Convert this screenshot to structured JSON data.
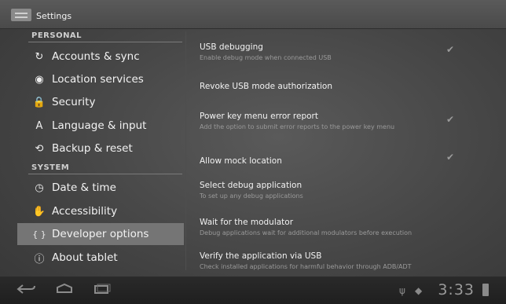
{
  "app_bar": {
    "title": "Settings",
    "icon": "settings-icon"
  },
  "sidebar": {
    "sections": [
      {
        "header": "PERSONAL",
        "items": [
          {
            "label": "Accounts & sync",
            "icon": "sync-icon",
            "glyph": "↻"
          },
          {
            "label": "Location services",
            "icon": "location-icon",
            "glyph": "◉"
          },
          {
            "label": "Security",
            "icon": "lock-icon",
            "glyph": "🔒"
          },
          {
            "label": "Language & input",
            "icon": "language-icon",
            "glyph": "A"
          },
          {
            "label": "Backup & reset",
            "icon": "backup-icon",
            "glyph": "⟲"
          }
        ]
      },
      {
        "header": "SYSTEM",
        "items": [
          {
            "label": "Date & time",
            "icon": "clock-icon",
            "glyph": "◷"
          },
          {
            "label": "Accessibility",
            "icon": "hand-icon",
            "glyph": "✋"
          },
          {
            "label": "Developer options",
            "icon": "braces-icon",
            "glyph": "{ }",
            "selected": true
          },
          {
            "label": "About tablet",
            "icon": "info-icon",
            "glyph": "ⓘ"
          }
        ]
      }
    ]
  },
  "settings": [
    {
      "title": "USB debugging",
      "summary": "Enable debug mode when connected USB",
      "checkbox": true,
      "checked": true
    },
    {
      "title": "Revoke USB mode authorization",
      "summary": "",
      "checkbox": false
    },
    {
      "title": "Power key menu error report",
      "summary": "Add the option to submit error reports to the power key menu",
      "checkbox": true,
      "checked": true
    },
    {
      "title": "Allow mock location",
      "summary": "",
      "checkbox": true,
      "checked": true
    },
    {
      "title": "Select debug application",
      "summary": "To set up any debug applications",
      "checkbox": false
    },
    {
      "title": "Wait for the modulator",
      "summary": "Debug applications wait for additional modulators before execution",
      "checkbox": false
    },
    {
      "title": "Verify the application via USB",
      "summary": "Check installed applications for harmful behavior through ADB/ADT",
      "checkbox": false
    }
  ],
  "system_bar": {
    "back": "back-icon",
    "home": "home-icon",
    "recents": "recent-apps-icon",
    "time": "3:33",
    "status_icons": [
      "usb-icon",
      "signal-icon",
      "battery-icon"
    ]
  }
}
